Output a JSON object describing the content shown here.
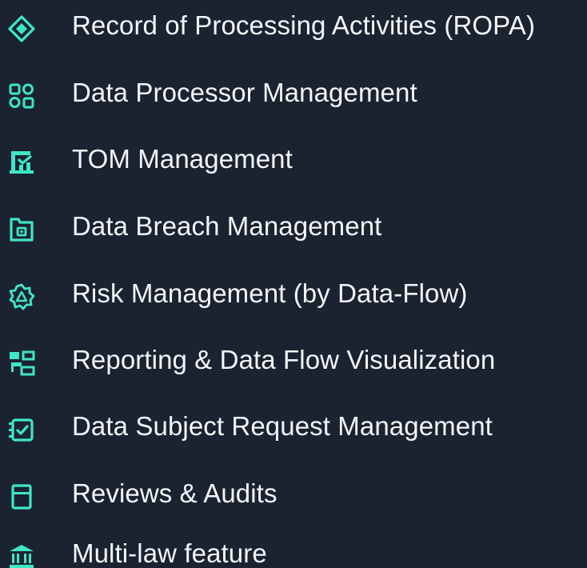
{
  "accent_color": "#3fe6c6",
  "background_color": "#1b2331",
  "menu": {
    "items": [
      {
        "icon": "diamond-icon",
        "label": "Record of Processing Activities (ROPA)"
      },
      {
        "icon": "processor-nodes-icon",
        "label": "Data Processor Management"
      },
      {
        "icon": "measure-checklist-icon",
        "label": "TOM Management"
      },
      {
        "icon": "folder-lock-icon",
        "label": "Data Breach Management"
      },
      {
        "icon": "warning-gear-icon",
        "label": "Risk Management (by Data-Flow)"
      },
      {
        "icon": "flow-chart-icon",
        "label": "Reporting & Data Flow Visualization"
      },
      {
        "icon": "checkbox-request-icon",
        "label": "Data Subject Request Management"
      },
      {
        "icon": "archive-box-icon",
        "label": "Reviews & Audits"
      },
      {
        "icon": "bank-icon",
        "label": "Multi-law feature"
      }
    ]
  }
}
